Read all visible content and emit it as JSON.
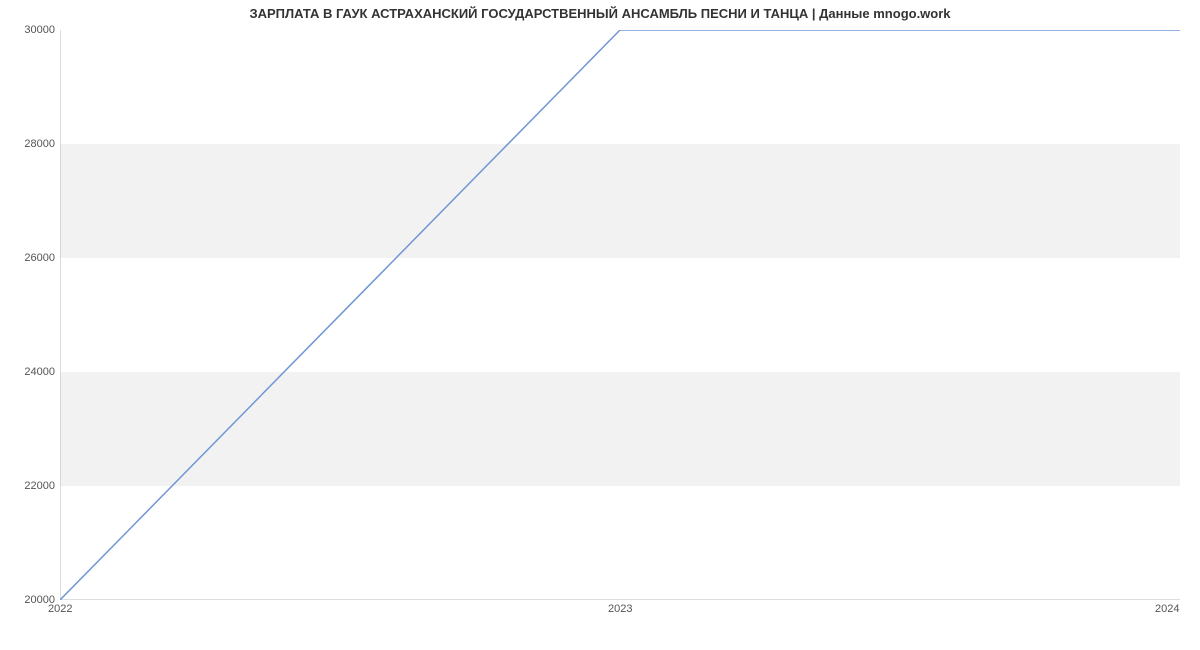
{
  "chart_data": {
    "type": "line",
    "title": "ЗАРПЛАТА В ГАУК АСТРАХАНСКИЙ ГОСУДАРСТВЕННЫЙ АНСАМБЛЬ ПЕСНИ И ТАНЦА | Данные mnogo.work",
    "x": [
      2022,
      2023,
      2024
    ],
    "values": [
      20000,
      30000,
      30000
    ],
    "x_ticks": [
      "2022",
      "2023",
      "2024"
    ],
    "y_ticks": [
      "20000",
      "22000",
      "24000",
      "26000",
      "28000",
      "30000"
    ],
    "xlim": [
      2022,
      2024
    ],
    "ylim": [
      20000,
      30000
    ],
    "xlabel": "",
    "ylabel": ""
  }
}
